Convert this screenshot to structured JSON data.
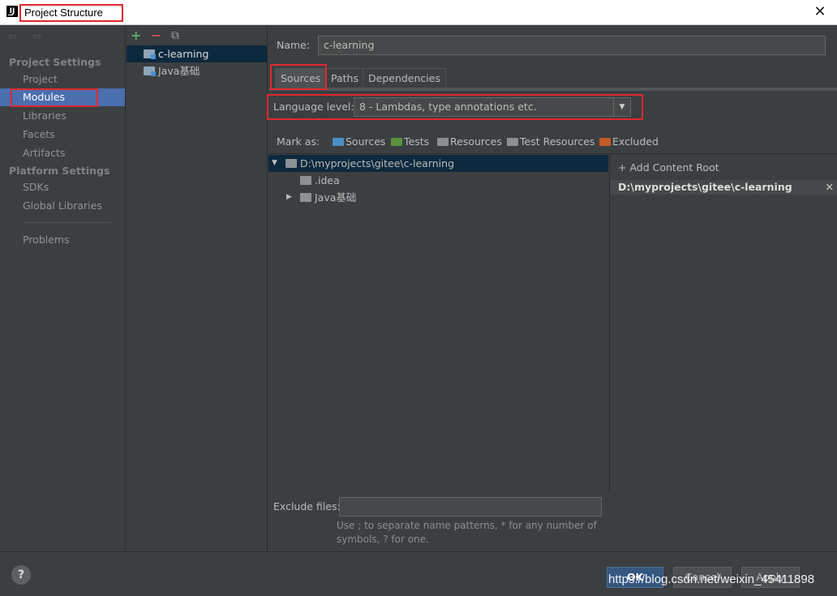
{
  "window": {
    "title": "Project Structure",
    "close_glyph": "✕"
  },
  "sidebar": {
    "back_forward": "⇦ ⇨",
    "project_settings_header": "Project Settings",
    "project_items": [
      {
        "label": "Project"
      },
      {
        "label": "Modules"
      },
      {
        "label": "Libraries"
      },
      {
        "label": "Facets"
      },
      {
        "label": "Artifacts"
      }
    ],
    "platform_settings_header": "Platform Settings",
    "platform_items": [
      {
        "label": "SDKs"
      },
      {
        "label": "Global Libraries"
      }
    ],
    "problems": "Problems",
    "selected": "Modules"
  },
  "modules_panel": {
    "add": "+",
    "remove": "−",
    "copy": "⧉",
    "items": [
      {
        "label": "c-learning"
      },
      {
        "label": "Java基础"
      }
    ]
  },
  "main": {
    "name_label": "Name:",
    "name_value": "c-learning",
    "tabs": [
      {
        "label": "Sources"
      },
      {
        "label": "Paths"
      },
      {
        "label": "Dependencies"
      }
    ],
    "language_level_label": "Language level:",
    "language_level_value": "8 - Lambdas, type annotations etc.",
    "dropdown_arrow": "▼",
    "mark_as_label": "Mark as:",
    "mark_as": [
      {
        "label": "Sources",
        "color": "#4a8fc7"
      },
      {
        "label": "Tests",
        "color": "#5b8f3a"
      },
      {
        "label": "Resources",
        "color": "#8b8f94"
      },
      {
        "label": "Test Resources",
        "color": "#8b8f94"
      },
      {
        "label": "Excluded",
        "color": "#c45b28"
      }
    ],
    "tree": [
      {
        "label": "D:\\myprojects\\gitee\\c-learning",
        "toggle": "▼"
      },
      {
        "label": ".idea",
        "toggle": ""
      },
      {
        "label": "Java基础",
        "toggle": "▶"
      }
    ],
    "add_content_root": "+ Add Content Root",
    "content_root": "D:\\myprojects\\gitee\\c-learning",
    "content_root_remove": "✕",
    "exclude_label": "Exclude files:",
    "exclude_value": "",
    "exclude_hint": "Use ; to separate name patterns, * for any number of symbols, ? for one."
  },
  "footer": {
    "help": "?",
    "ok": "OK",
    "cancel": "Cancel",
    "apply": "Apply",
    "watermark": "https://blog.csdn.net/weixin_45411898"
  }
}
